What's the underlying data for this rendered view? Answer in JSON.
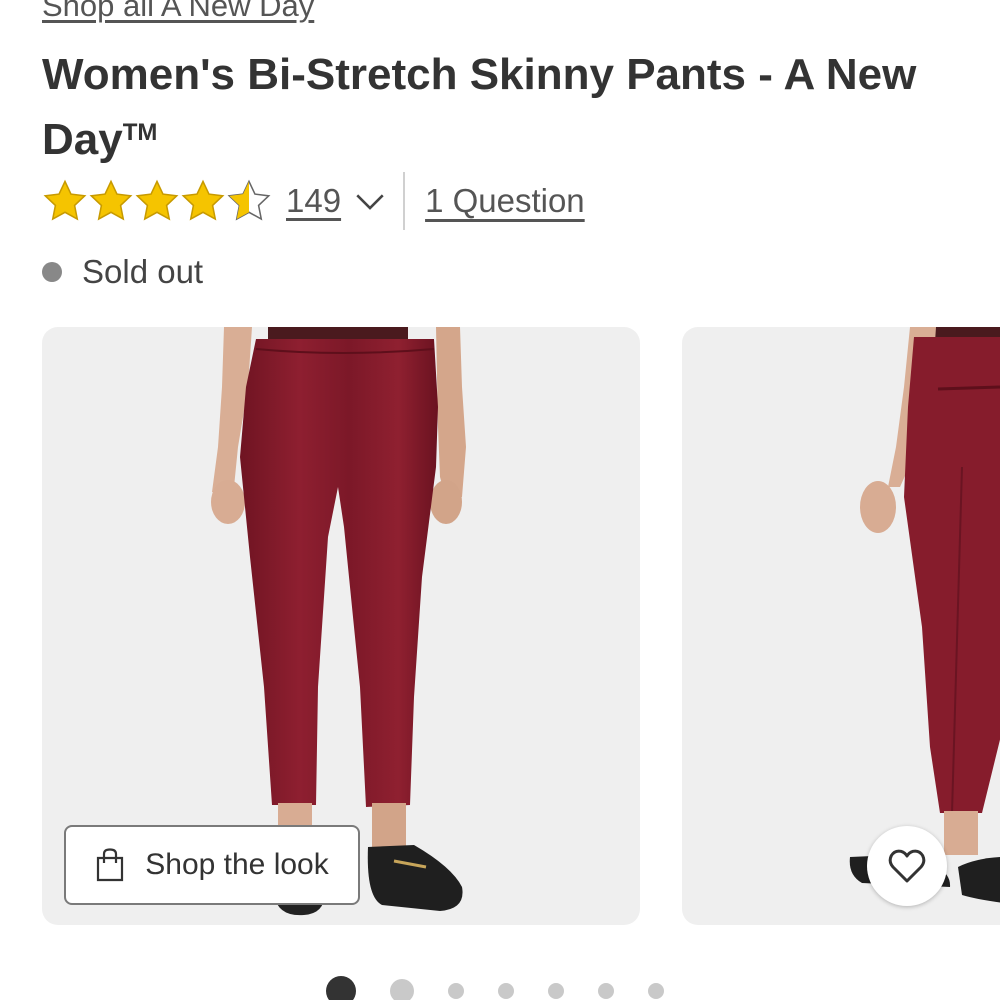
{
  "product": {
    "brand_link": "Shop all A New Day",
    "title": "Women's Bi-Stretch Skinny Pants - A New Day",
    "trademark": "TM",
    "rating_value": 4.5,
    "rating_max": 5,
    "review_count": "149",
    "questions_link": "1 Question",
    "status": "Sold out"
  },
  "gallery": {
    "images": [
      {
        "icon": "product-photo-front"
      },
      {
        "icon": "product-photo-back"
      }
    ],
    "shop_the_look": "Shop the look",
    "favorite_icon": "heart-icon",
    "carousel_total_dots": 7,
    "carousel_active_index": 0
  },
  "colors": {
    "star": "#f5c400",
    "pants": "#8a1c2c",
    "card_bg": "#efefef",
    "status_dot": "#888888"
  }
}
